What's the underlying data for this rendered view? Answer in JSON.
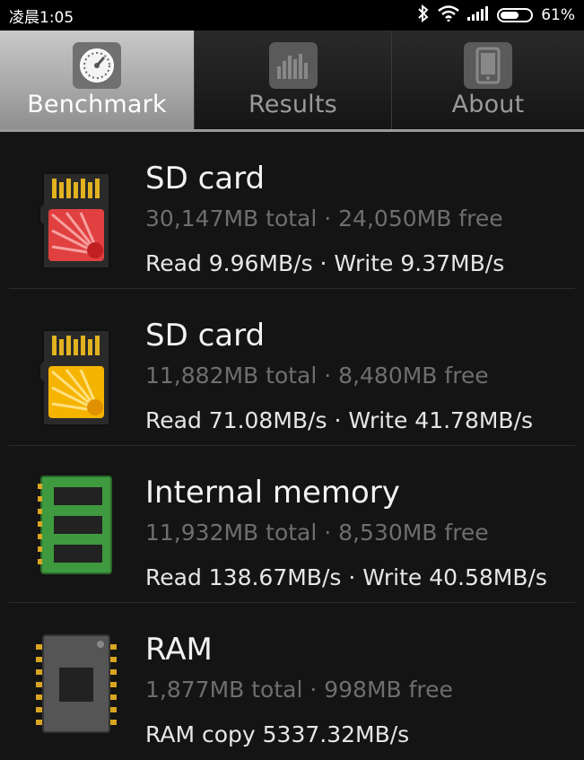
{
  "status_bar": {
    "time": "凌晨1:05",
    "battery_percent": "61%",
    "battery_level": 0.61,
    "icons": [
      "bluetooth-icon",
      "wifi-icon",
      "signal-icon",
      "battery-icon"
    ]
  },
  "tabs": [
    {
      "label": "Benchmark",
      "icon": "speedometer-icon",
      "active": true
    },
    {
      "label": "Results",
      "icon": "bar-chart-icon",
      "active": false
    },
    {
      "label": "About",
      "icon": "phone-icon",
      "active": false
    }
  ],
  "items": [
    {
      "title": "SD card",
      "capacity": "30,147MB total · 24,050MB free",
      "speed": "Read 9.96MB/s · Write 9.37MB/s",
      "icon": "sd-card-red-icon",
      "accent": "#e04040"
    },
    {
      "title": "SD card",
      "capacity": "11,882MB total · 8,480MB free",
      "speed": "Read 71.08MB/s · Write 41.78MB/s",
      "icon": "sd-card-yellow-icon",
      "accent": "#f5b400"
    },
    {
      "title": "Internal memory",
      "capacity": "11,932MB total · 8,530MB free",
      "speed": "Read 138.67MB/s · Write 40.58MB/s",
      "icon": "memory-chip-icon",
      "accent": "#3f9a3f"
    },
    {
      "title": "RAM",
      "capacity": "1,877MB total · 998MB free",
      "speed": "RAM copy 5337.32MB/s",
      "icon": "ram-chip-icon",
      "accent": "#d9a520"
    }
  ]
}
